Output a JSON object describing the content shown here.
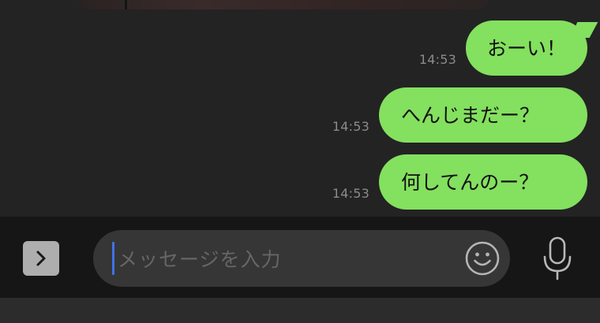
{
  "messages": [
    {
      "time": "14:53",
      "text": "おーい！"
    },
    {
      "time": "14:53",
      "text": "へんじまだー？"
    },
    {
      "time": "14:53",
      "text": "何してんのー？"
    }
  ],
  "composer": {
    "placeholder": "メッセージを入力"
  },
  "icons": {
    "expand": "chevron-right-icon",
    "emoji": "smiley-icon",
    "mic": "microphone-icon"
  },
  "colors": {
    "bubble": "#84e05f",
    "caret": "#3f73e6",
    "background": "#232323"
  }
}
